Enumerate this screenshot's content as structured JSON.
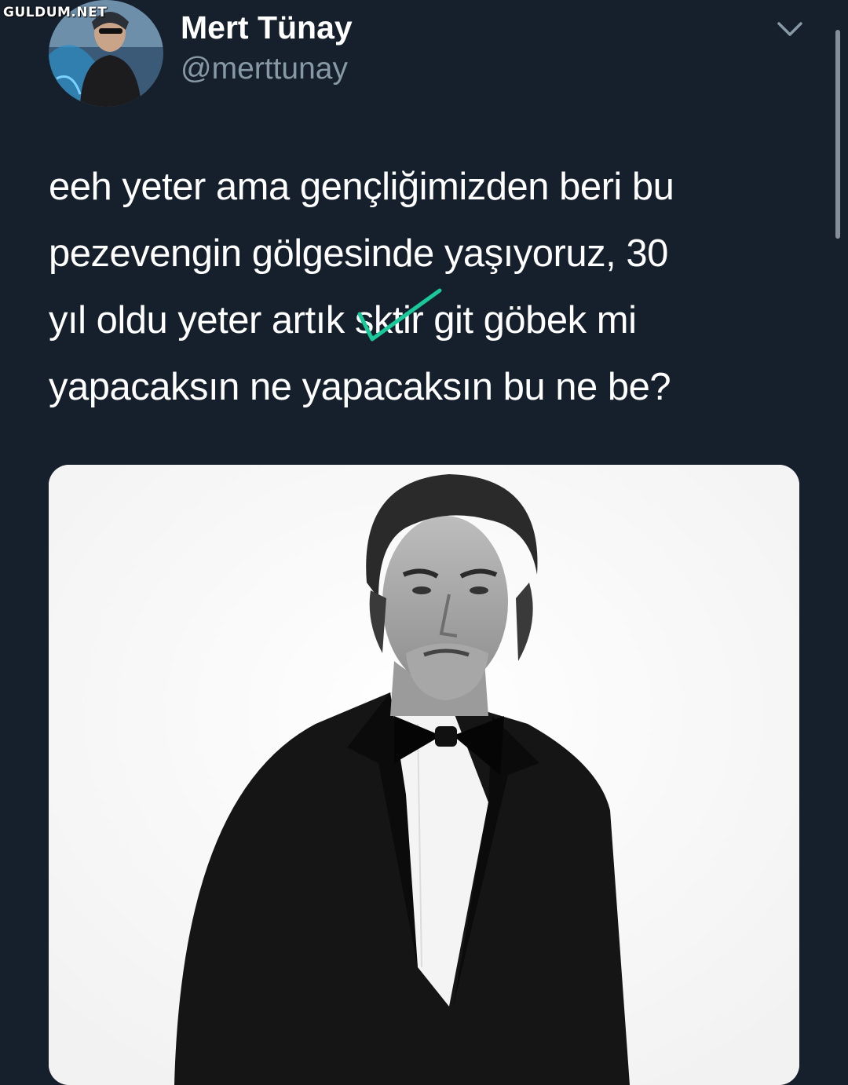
{
  "watermark": {
    "text": "GULDUM.NET"
  },
  "tweet": {
    "author": {
      "display_name": "Mert Tünay",
      "handle": "@merttunay"
    },
    "text_lines": [
      "eeh yeter ama gençliğimizden beri bu",
      "pezevengin gölgesinde yaşıyoruz, 30",
      "yıl oldu yeter artık",
      "sktir",
      "git göbek mi",
      "yapacaksın ne yapacaksın bu ne be?"
    ],
    "menu_icon": "chevron-down-icon",
    "media": {
      "kind": "black-and-white portrait photo"
    }
  },
  "colors": {
    "background": "#16202c",
    "text": "#ffffff",
    "secondary_text": "#8899a6",
    "check_mark": "#19c99a"
  }
}
